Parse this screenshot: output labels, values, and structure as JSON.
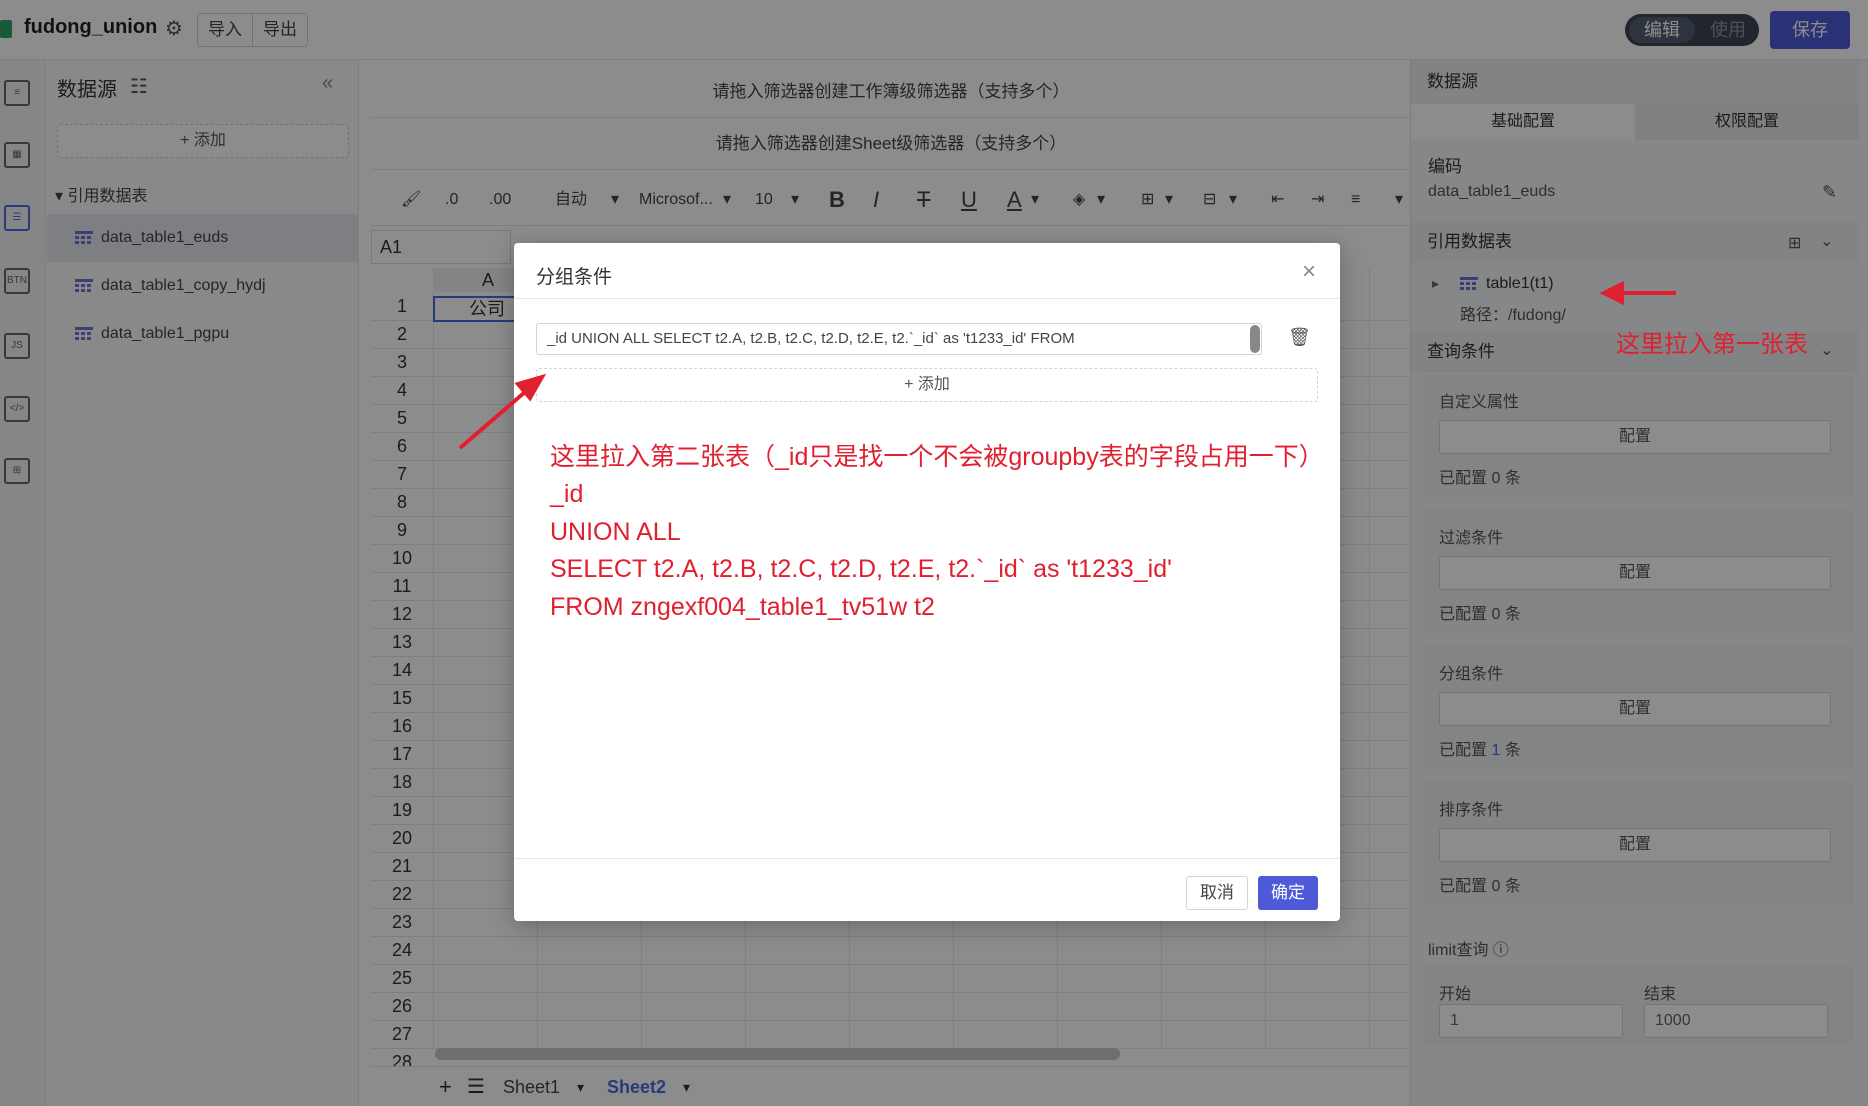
{
  "app": {
    "title": "fudong_union",
    "import_label": "导入",
    "export_label": "导出",
    "mode_edit": "编辑",
    "mode_use": "使用",
    "save_label": "保存"
  },
  "datasource": {
    "title": "数据源",
    "add_label": "+ 添加",
    "ref_label": "引用数据表",
    "items": [
      "data_table1_euds",
      "data_table1_copy_hydj",
      "data_table1_pgpu"
    ]
  },
  "main": {
    "workbook_filter": "请拖入筛选器创建工作簿级筛选器（支持多个）",
    "sheet_filter": "请拖入筛选器创建Sheet级筛选器（支持多个）",
    "toolbar": {
      "auto": "自动",
      "font": "Microsof...",
      "size": "10"
    },
    "cell_ref": "A1",
    "col_a": "A",
    "a1_value": "公司",
    "sheets": [
      "Sheet1",
      "Sheet2"
    ]
  },
  "config": {
    "header": "数据源",
    "tab_basic": "基础配置",
    "tab_perm": "权限配置",
    "code_label": "编码",
    "code_value": "data_table1_euds",
    "ref_table_label": "引用数据表",
    "table_name": "table1(t1)",
    "table_path": "路径：/fudong/",
    "query_label": "查询条件",
    "sections": [
      {
        "title": "自定义属性",
        "btn": "配置",
        "status_pre": "已配置",
        "count": "0",
        "status_post": "条"
      },
      {
        "title": "过滤条件",
        "btn": "配置",
        "status_pre": "已配置",
        "count": "0",
        "status_post": "条"
      },
      {
        "title": "分组条件",
        "btn": "配置",
        "status_pre": "已配置",
        "count": "1",
        "status_post": "条"
      },
      {
        "title": "排序条件",
        "btn": "配置",
        "status_pre": "已配置",
        "count": "0",
        "status_post": "条"
      }
    ],
    "limit_label": "limit查询",
    "start_label": "开始",
    "start_value": "1",
    "end_label": "结束",
    "end_value": "1000"
  },
  "modal": {
    "title": "分组条件",
    "sql_value": "_id UNION ALL SELECT t2.A, t2.B, t2.C, t2.D, t2.E, t2.`_id` as 't1233_id' FROM",
    "add_label": "+ 添加",
    "annotation_lines": [
      "这里拉入第二张表（_id只是找一个不会被groupby表的字段占用一下）",
      "_id",
      "UNION ALL",
      "SELECT t2.A, t2.B, t2.C, t2.D, t2.E, t2.`_id` as 't1233_id'",
      "FROM zngexf004_table1_tv51w t2"
    ],
    "cancel_label": "取消",
    "ok_label": "确定"
  },
  "annotation_right": "这里拉入第一张表",
  "colors": {
    "accent": "#4e5ad8",
    "annotation": "#e0202f"
  }
}
